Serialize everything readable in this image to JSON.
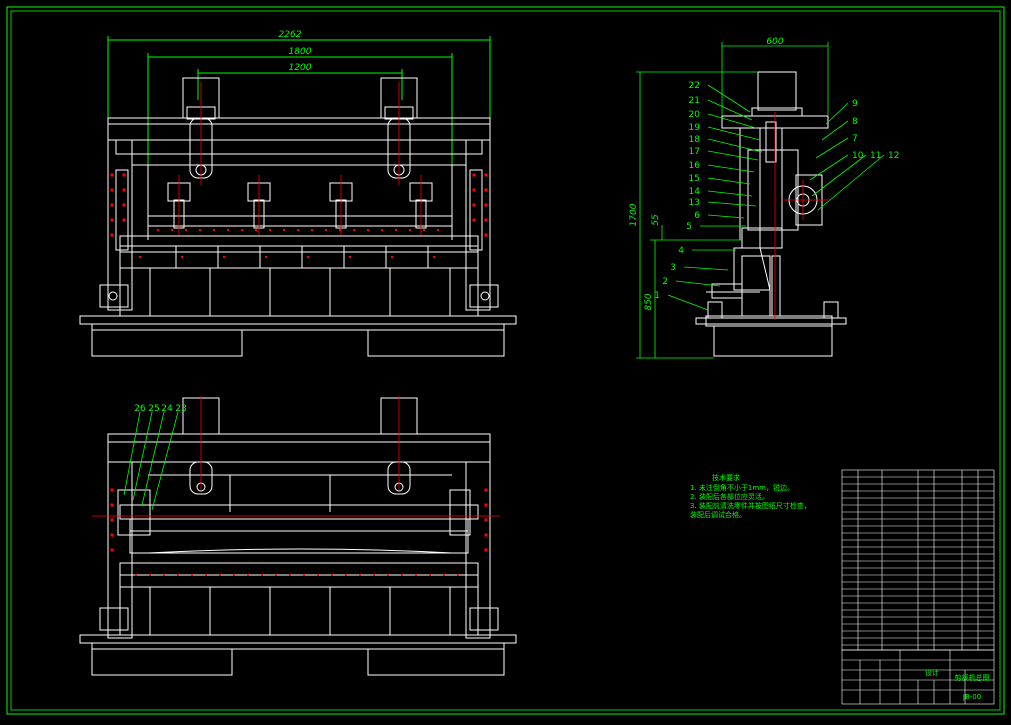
{
  "colors": {
    "background": "#000000",
    "frame": "#00ff00",
    "outline": "#ffffff",
    "dimension": "#00ff00",
    "centerline": "#ff0000",
    "bolt": "#ff0000",
    "table_text": "#00ff00"
  },
  "front_view": {
    "dims": [
      "2262",
      "1800",
      "1200"
    ]
  },
  "side_view": {
    "dims": {
      "width": "600",
      "height": "1700",
      "lower": "850",
      "gap": "55"
    },
    "balloons_left": [
      "22",
      "21",
      "20",
      "19",
      "18",
      "17",
      "16",
      "15",
      "14",
      "13",
      "6",
      "5",
      "4",
      "3",
      "2",
      "1"
    ],
    "balloons_right": [
      "9",
      "8",
      "7",
      "10",
      "11",
      "12"
    ]
  },
  "bottom_view": {
    "balloons": [
      "26",
      "25",
      "24",
      "23"
    ]
  },
  "notes": {
    "title": "技术要求",
    "lines": [
      "1. 未注倒角不小于1mm，锐边。",
      "2. 装配后各部位应灵活。",
      "3. 装配前清洗零件并按图纸尺寸检查，",
      "   装配后调试合格。"
    ]
  },
  "title_block": {
    "design_label": "设计",
    "title": "剪板机总图",
    "drawing_no": "JB-00"
  }
}
